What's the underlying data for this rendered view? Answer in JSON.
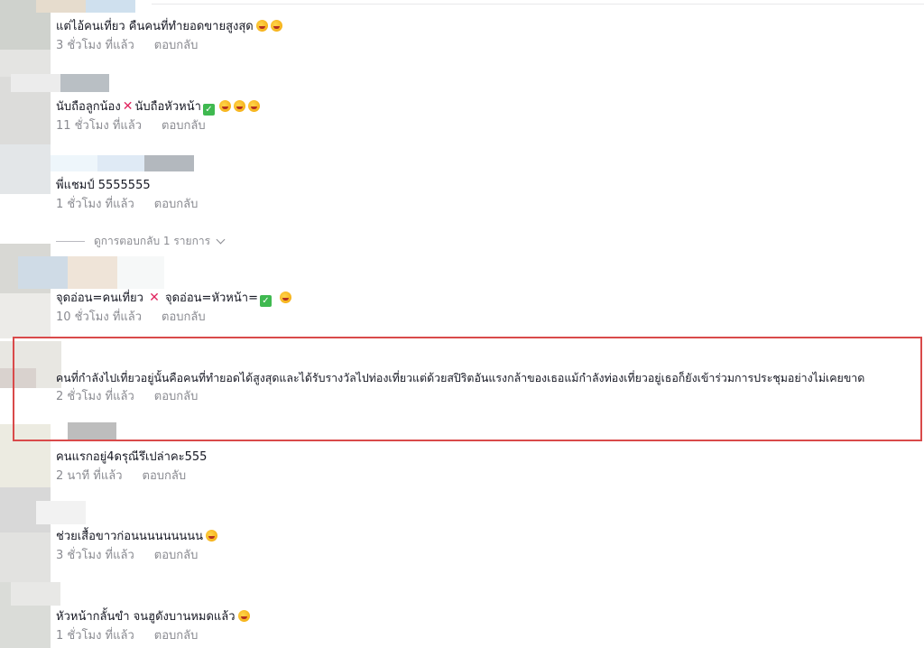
{
  "comments": [
    {
      "text": "แต่ไอ้คนเที่ยว คืนคนที่ทำยอดขายสูงสุด",
      "time": "3 ชั่วโมง ที่แล้ว",
      "reply": "ตอบกลับ"
    },
    {
      "text_a": "นับถือลูกน้อง",
      "text_b": "นับถือหัวหน้า",
      "time": "11 ชั่วโมง ที่แล้ว",
      "reply": "ตอบกลับ"
    },
    {
      "text": "พี่แชมป์ 5555555",
      "time": "1 ชั่วโมง ที่แล้ว",
      "reply": "ตอบกลับ"
    },
    {
      "text_a": "จุดอ่อน=คนเที่ยว",
      "text_b": "จุดอ่อน=หัวหน้า=",
      "time": "10 ชั่วโมง ที่แล้ว",
      "reply": "ตอบกลับ"
    },
    {
      "text": "คนที่กำลังไปเที่ยวอยู่นั้นคือคนที่ทำยอดได้สูงสุดและได้รับรางวัลไปท่องเที่ยวแต่ด้วยสปิริตอันแรงกล้าของเธอแม้กำลังท่องเที่ยวอยู่เธอก็ยังเข้าร่วมการประชุมอย่างไม่เคยขาด",
      "time": "2 ชั่วโมง ที่แล้ว",
      "reply": "ตอบกลับ"
    },
    {
      "text": "คนแรกอยู่4ดรุณีรึเปล่าคะ555",
      "time": "2 นาที ที่แล้ว",
      "reply": "ตอบกลับ"
    },
    {
      "text": "ช่วยเสื้อขาวก่อนนนนนนนนน",
      "time": "3 ชั่วโมง ที่แล้ว",
      "reply": "ตอบกลับ"
    },
    {
      "text": "หัวหน้ากลั้นขำ จนฮูดังบานหมดแล้ว",
      "time": "1 ชั่วโมง ที่แล้ว",
      "reply": "ตอบกลับ"
    }
  ],
  "view_replies": "ดูการตอบกลับ 1 รายการ",
  "icons": {
    "emoji": "rofl-emoji-icon",
    "cross": "cross-mark-icon",
    "check": "check-mark-icon",
    "chevron": "chevron-down-icon"
  }
}
